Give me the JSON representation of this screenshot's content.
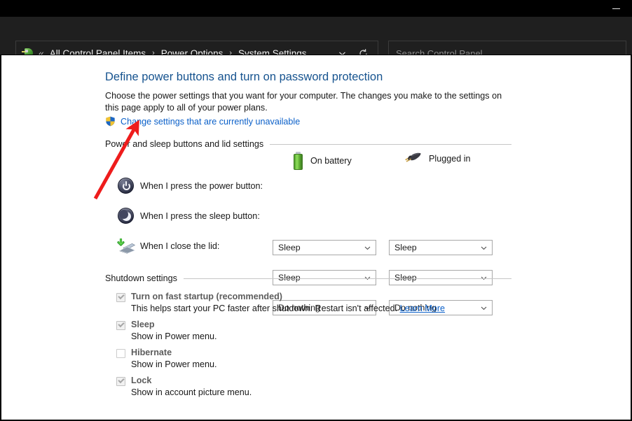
{
  "window": {
    "minimize_label": "—"
  },
  "nav": {
    "cp_icon": "control-panel-icon",
    "back_chevrons": "«",
    "breadcrumbs": [
      {
        "label": "All Control Panel Items"
      },
      {
        "label": "Power Options"
      },
      {
        "label": "System Settings"
      }
    ],
    "separator": "›",
    "history_icon": "chevron-down-icon",
    "refresh_icon": "refresh-icon",
    "search": {
      "placeholder": "Search Control Panel",
      "value": ""
    }
  },
  "page": {
    "title": "Define power buttons and turn on password protection",
    "intro": "Choose the power settings that you want for your computer. The changes you make to the settings on this page apply to all of your power plans.",
    "uac_link": "Change settings that are currently unavailable",
    "uac_icon": "shield-icon"
  },
  "power_section": {
    "header": "Power and sleep buttons and lid settings",
    "columns": [
      {
        "label": "On battery",
        "icon": "battery-icon"
      },
      {
        "label": "Plugged in",
        "icon": "power-plug-icon"
      }
    ],
    "rows": [
      {
        "icon": "power-button-icon",
        "label": "When I press the power button:",
        "on_battery": "Sleep",
        "plugged_in": "Sleep"
      },
      {
        "icon": "sleep-moon-icon",
        "label": "When I press the sleep button:",
        "on_battery": "Sleep",
        "plugged_in": "Sleep"
      },
      {
        "icon": "laptop-lid-icon",
        "label": "When I close the lid:",
        "on_battery": "Do nothing",
        "plugged_in": "Do nothing"
      }
    ],
    "dropdown_chevron": "chevron-down-icon"
  },
  "shutdown_section": {
    "header": "Shutdown settings",
    "items": [
      {
        "title": "Turn on fast startup (recommended)",
        "checked": true,
        "desc": "This helps start your PC faster after shutdown. Restart isn't affected.",
        "link": "Learn More"
      },
      {
        "title": "Sleep",
        "checked": true,
        "desc": "Show in Power menu.",
        "link": ""
      },
      {
        "title": "Hibernate",
        "checked": false,
        "desc": "Show in Power menu.",
        "link": ""
      },
      {
        "title": "Lock",
        "checked": true,
        "desc": "Show in account picture menu.",
        "link": ""
      }
    ]
  },
  "annotation": {
    "arrow_color": "#ee1c1c",
    "name": "red-pointer-arrow"
  },
  "colors": {
    "title_blue": "#16538f",
    "link_blue": "#0b60c9",
    "chrome_dark": "#1f1f1f",
    "page_white": "#ffffff"
  }
}
